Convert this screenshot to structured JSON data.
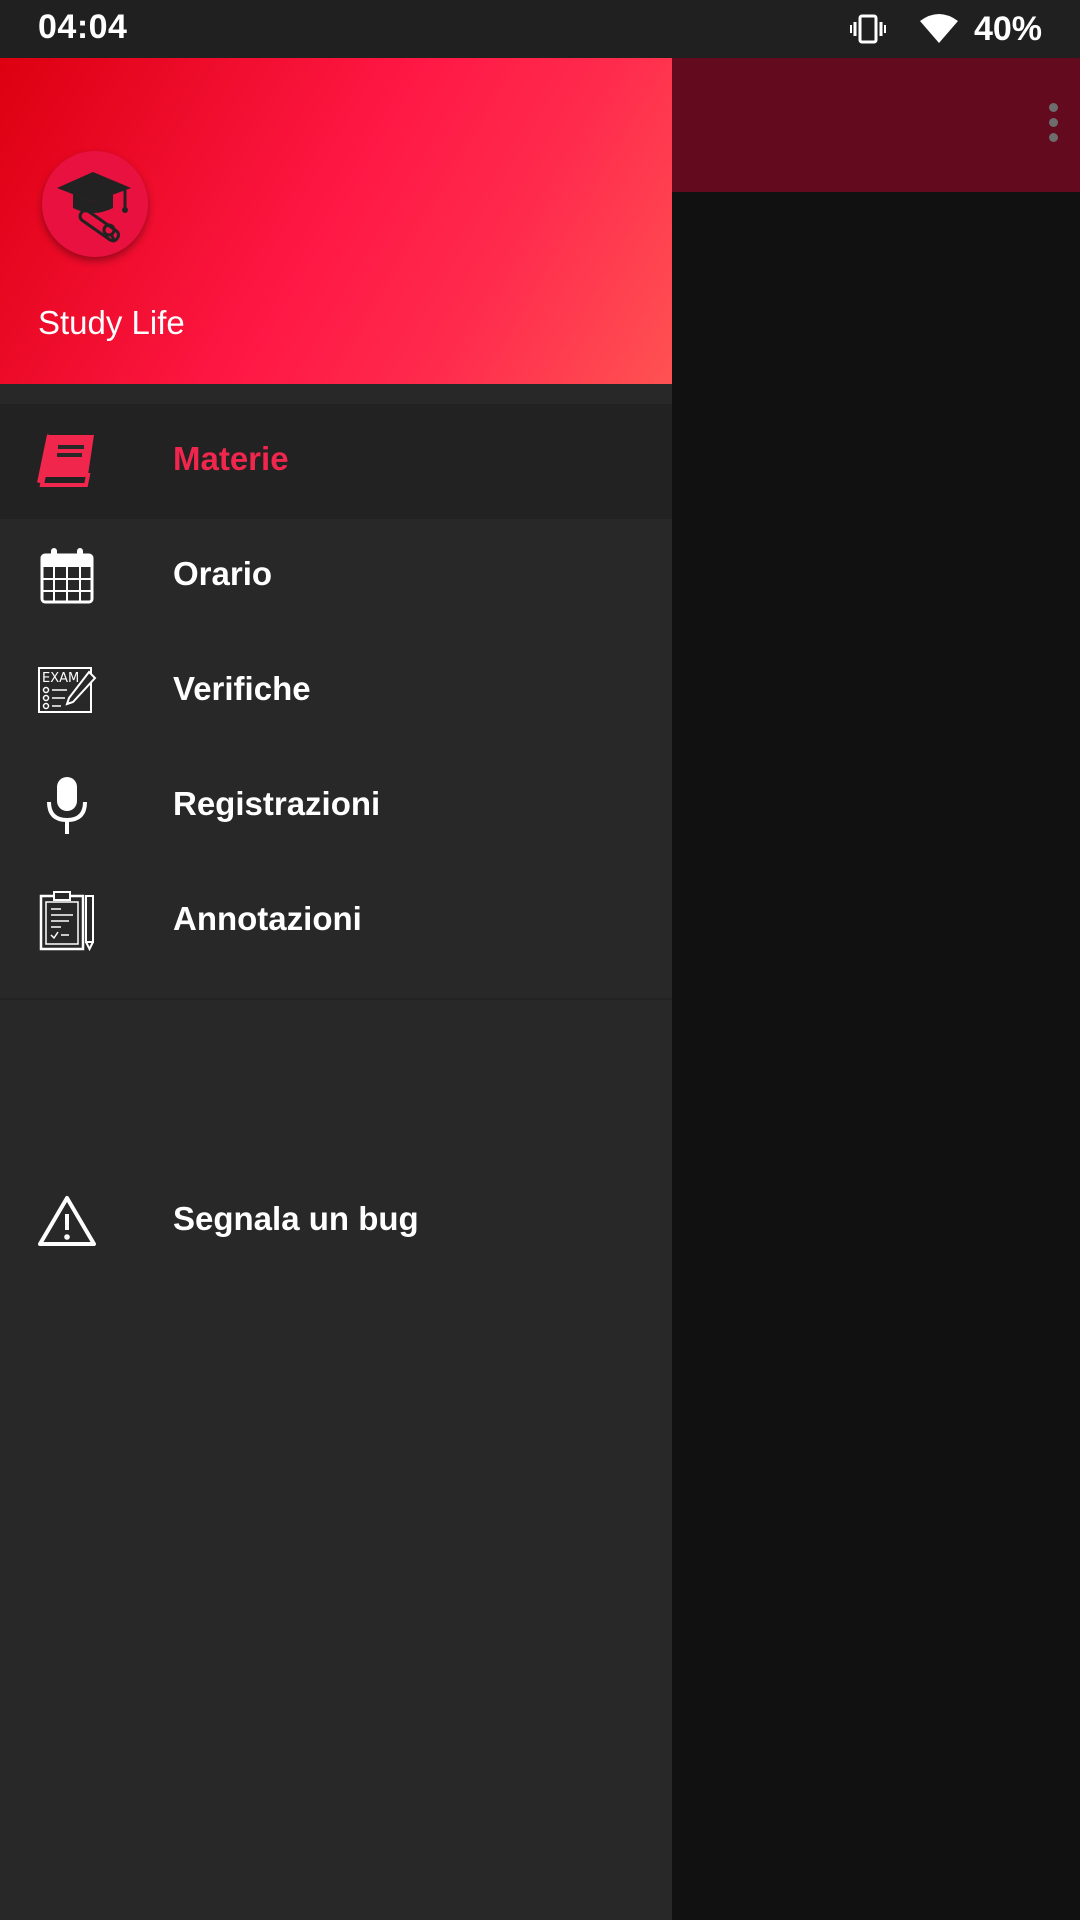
{
  "status_bar": {
    "time": "04:04",
    "battery": "40%",
    "icons": [
      "vibrate-icon",
      "wifi-icon"
    ]
  },
  "toolbar": {
    "overflow_icon": "more-vert-icon"
  },
  "drawer": {
    "header": {
      "app_name": "Study Life",
      "logo_icon": "graduation-cap-icon"
    },
    "items": [
      {
        "label": "Materie",
        "icon": "book-icon",
        "active": true
      },
      {
        "label": "Orario",
        "icon": "calendar-icon",
        "active": false
      },
      {
        "label": "Verifiche",
        "icon": "exam-icon",
        "active": false
      },
      {
        "label": "Registrazioni",
        "icon": "microphone-icon",
        "active": false
      },
      {
        "label": "Annotazioni",
        "icon": "clipboard-icon",
        "active": false
      }
    ],
    "secondary_items": [
      {
        "label": "Segnala un bug",
        "icon": "warning-icon"
      }
    ]
  },
  "colors": {
    "accent": "#f0264d",
    "header_gradient_start": "#dc0010",
    "header_gradient_end": "#ff5252",
    "drawer_bg": "#282828",
    "toolbar_bg": "#640a1e",
    "status_bar_bg": "#202020"
  }
}
